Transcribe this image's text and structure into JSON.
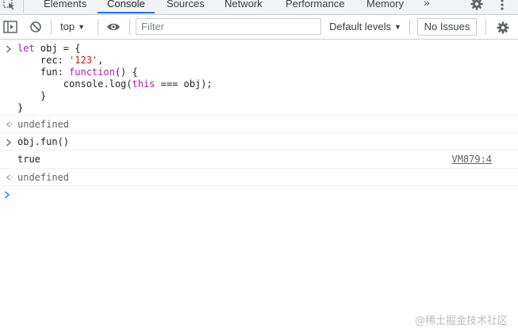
{
  "tabs": {
    "items": [
      "Elements",
      "Console",
      "Sources",
      "Network",
      "Performance",
      "Memory"
    ],
    "active": "Console",
    "more": "»"
  },
  "toolbar": {
    "context": "top",
    "filter_placeholder": "Filter",
    "levels": "Default levels",
    "issues": "No Issues"
  },
  "console": {
    "input1": [
      "let obj = {",
      "    rec: '123',",
      "    fun: function() {",
      "        console.log(this === obj);",
      "    }",
      "}"
    ],
    "result1": "undefined",
    "input2": "obj.fun()",
    "log_value": "true",
    "log_source": "VM879:4",
    "result2": "undefined"
  },
  "watermark": "@稀土掘金技术社区",
  "colors": {
    "accent": "#1a73e8",
    "keyword": "#a626a4",
    "string": "#c41a16",
    "muted": "#5f6368"
  },
  "icons": {
    "inspect": "cursor-select-icon",
    "sidebar": "console-sidebar-icon",
    "clear": "clear-console-icon",
    "eye": "live-expression-icon",
    "settings": "gear-icon",
    "menu": "kebab-menu-icon",
    "prompt": "chevron-right-icon",
    "return": "return-arrow-icon"
  }
}
